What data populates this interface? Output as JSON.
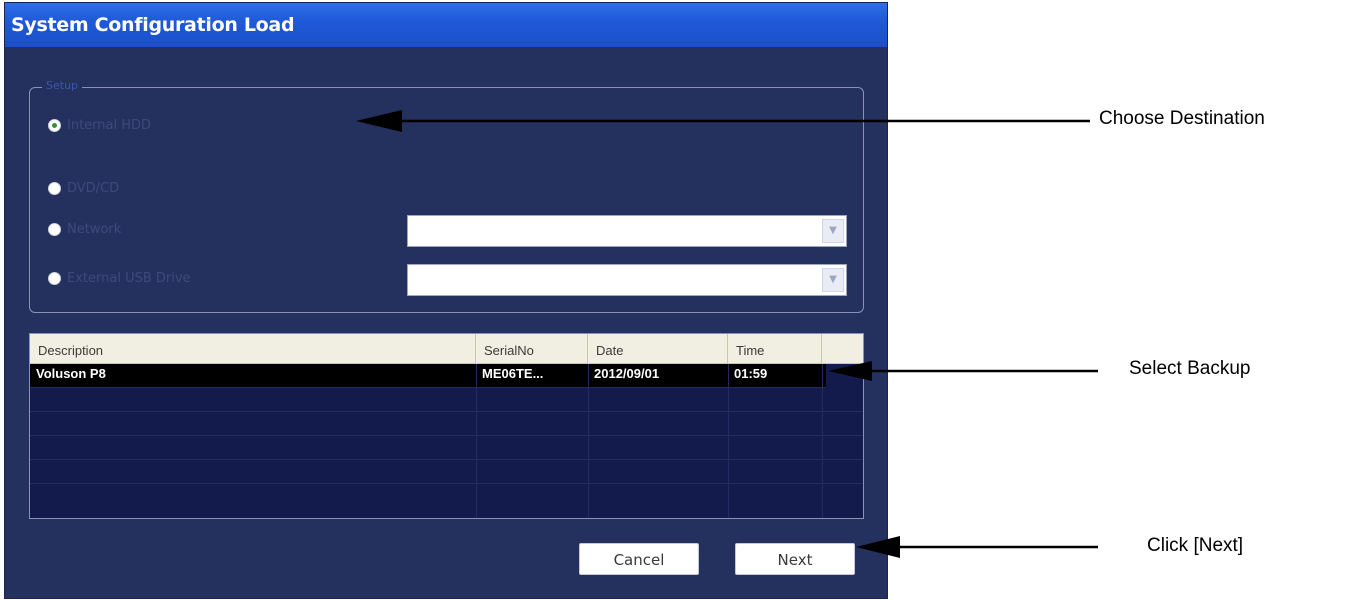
{
  "window": {
    "title": "System Configuration Load"
  },
  "group": {
    "legend": "Setup",
    "options": [
      {
        "label": "Internal HDD",
        "checked": true
      },
      {
        "label": "DVD/CD",
        "checked": false
      },
      {
        "label": "Network",
        "checked": false
      },
      {
        "label": "External USB Drive",
        "checked": false
      }
    ],
    "network_combo_value": "",
    "usb_combo_value": ""
  },
  "list": {
    "columns": [
      "Description",
      "SerialNo",
      "Date",
      "Time"
    ],
    "rows": [
      {
        "description": "Voluson P8",
        "serial": "ME06TE...",
        "date": "2012/09/01",
        "time": "01:59"
      }
    ]
  },
  "buttons": {
    "cancel": "Cancel",
    "next": "Next"
  },
  "annotations": {
    "choose_destination": "Choose Destination",
    "select_backup": "Select Backup",
    "click_next": "Click [Next]"
  }
}
